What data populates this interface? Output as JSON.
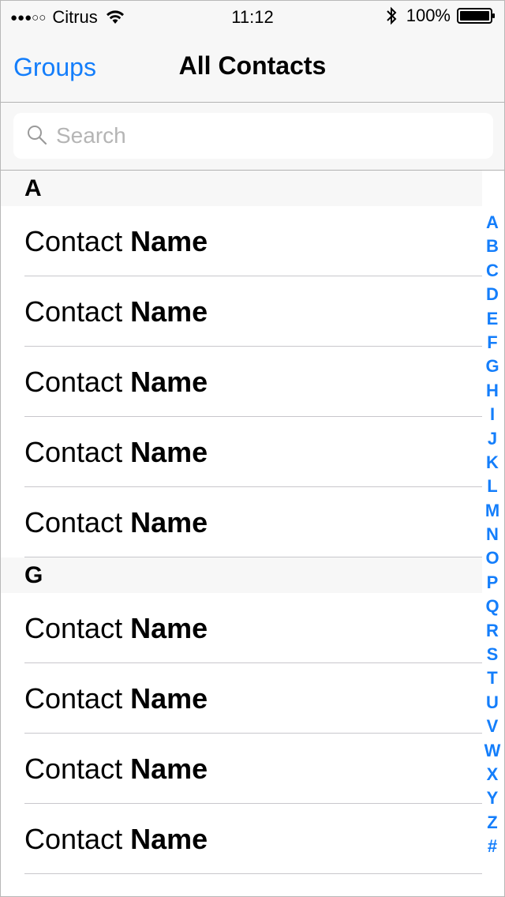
{
  "status_bar": {
    "signal": "●●●○○",
    "carrier": "Citrus",
    "time": "11:12",
    "battery_percent": "100%",
    "icons": [
      "wifi-icon",
      "bluetooth-icon",
      "battery-icon"
    ]
  },
  "nav": {
    "back_label": "Groups",
    "title": "All Contacts"
  },
  "search": {
    "placeholder": "Search",
    "value": ""
  },
  "sections": [
    {
      "letter": "A",
      "contacts": [
        {
          "first": "Contact",
          "last": "Name"
        },
        {
          "first": "Contact",
          "last": "Name"
        },
        {
          "first": "Contact",
          "last": "Name"
        },
        {
          "first": "Contact",
          "last": "Name"
        },
        {
          "first": "Contact",
          "last": "Name"
        }
      ]
    },
    {
      "letter": "G",
      "contacts": [
        {
          "first": "Contact",
          "last": "Name"
        },
        {
          "first": "Contact",
          "last": "Name"
        },
        {
          "first": "Contact",
          "last": "Name"
        },
        {
          "first": "Contact",
          "last": "Name"
        }
      ]
    }
  ],
  "index": [
    "A",
    "B",
    "C",
    "D",
    "E",
    "F",
    "G",
    "H",
    "I",
    "J",
    "K",
    "L",
    "M",
    "N",
    "O",
    "P",
    "Q",
    "R",
    "S",
    "T",
    "U",
    "V",
    "W",
    "X",
    "Y",
    "Z",
    "#"
  ],
  "colors": {
    "accent": "#147efb",
    "header_bg": "#f7f7f7",
    "separator": "#c8c7cc",
    "placeholder": "#b5b5b5"
  }
}
